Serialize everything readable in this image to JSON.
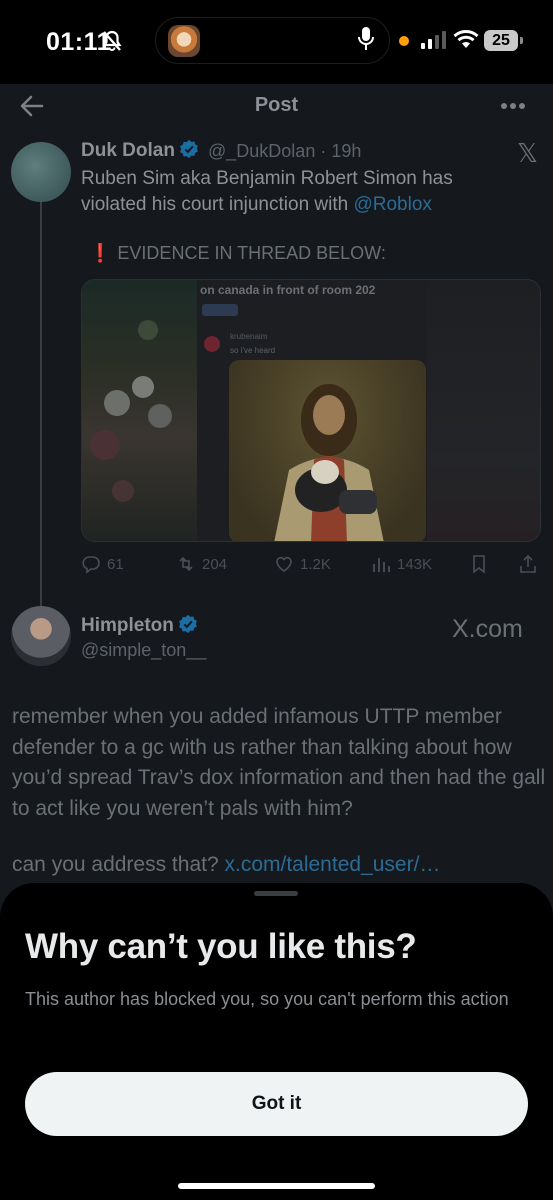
{
  "status_bar": {
    "time": "01:11",
    "battery": "25",
    "icons": [
      "bell-slash-icon",
      "microphone-icon",
      "orange-dot",
      "signal-icon",
      "wifi-icon",
      "battery-icon"
    ]
  },
  "header": {
    "title": "Post",
    "back_icon": "arrow-left-icon",
    "more_icon": "more-horizontal-icon"
  },
  "quoted_post": {
    "name": "Duk Dolan",
    "handle_time": "@_DukDolan · 19h",
    "text": "Ruben Sim aka Benjamin Robert Simon has violated his court injunction with ",
    "mention": "@Roblox",
    "evidence_mark": "❗",
    "evidence_text": "EVIDENCE IN THREAD BELOW:",
    "media": {
      "chat_title": "on canada in front of room 202",
      "chat_user": "krubenaim",
      "chat_message": "so i've heard"
    },
    "actions": {
      "replies": "61",
      "reposts": "204",
      "likes": "1.2K",
      "views": "143K"
    }
  },
  "reply_post": {
    "name": "Himpleton",
    "handle": "@simple_ton__",
    "source": "X.com",
    "text": "remember when you added infamous UTTP member defender to a gc with us rather than talking about how you’d spread Trav’s dox information and then had the gall to act like you weren’t pals with him?",
    "text2": "can you address that? ",
    "link": "x.com/talented_user/…"
  },
  "sheet": {
    "title": "Why can’t you like this?",
    "description": "This author has blocked you, so you can't perform this action",
    "button": "Got it"
  },
  "colors": {
    "background": "#15181c",
    "sheet": "#000000",
    "link": "#2a6c95",
    "verified": "#1d9bf0",
    "button": "#eff3f4"
  }
}
